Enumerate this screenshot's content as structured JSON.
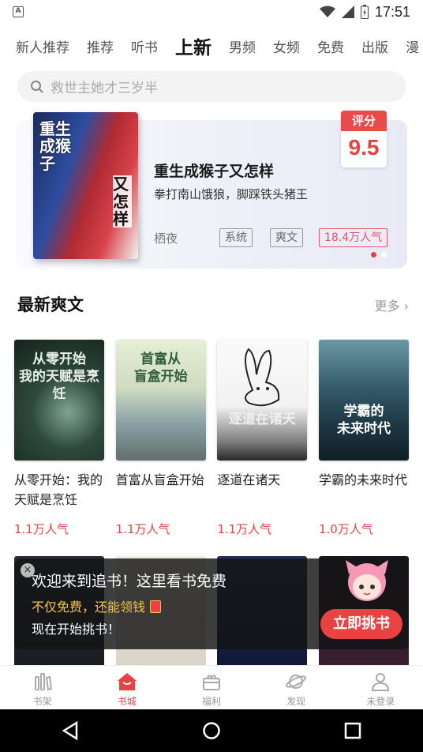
{
  "status_bar": {
    "time": "17:51",
    "left_icon": "A"
  },
  "tabs": [
    {
      "label": "新人推荐"
    },
    {
      "label": "推荐"
    },
    {
      "label": "听书"
    },
    {
      "label": "上新",
      "active": true
    },
    {
      "label": "男频"
    },
    {
      "label": "女频"
    },
    {
      "label": "免费"
    },
    {
      "label": "出版"
    },
    {
      "label": "漫"
    }
  ],
  "search": {
    "placeholder": "救世主她才三岁半"
  },
  "banner": {
    "title": "重生成猴子又怎样",
    "description": "拳打南山饿狼，脚踩铁头猪王",
    "author": "栖夜",
    "tags": [
      "系统",
      "爽文"
    ],
    "popularity": "18.4万人气",
    "score_label": "评分",
    "score_value": "9.5",
    "cover_text_1": "重生成猴子",
    "cover_text_2": "又怎样"
  },
  "section": {
    "title": "最新爽文",
    "more": "更多 ›"
  },
  "books": [
    {
      "name": "从零开始：我的天赋是烹饪",
      "popularity": "1.1万人气",
      "cover_text": "从零开始\n我的天赋是烹饪"
    },
    {
      "name": "首富从盲盒开始",
      "popularity": "1.1万人气",
      "cover_text": "首富从\n盲盒开始"
    },
    {
      "name": "逐道在诸天",
      "popularity": "1.1万人气",
      "cover_text": "逐道在诸天"
    },
    {
      "name": "学霸的未来时代",
      "popularity": "1.0万人气",
      "cover_text": "学霸的\n未来时代"
    }
  ],
  "promo": {
    "line1": "欢迎来到追书！这里看书免费",
    "line2": "不仅免费，还能领钱",
    "line3": "现在开始挑书！",
    "button": "立即挑书",
    "close": "×"
  },
  "bottom_nav": [
    {
      "label": "书架",
      "icon": "bookshelf-icon"
    },
    {
      "label": "书城",
      "icon": "bookstore-icon",
      "active": true
    },
    {
      "label": "福利",
      "icon": "gift-icon"
    },
    {
      "label": "发现",
      "icon": "planet-icon"
    },
    {
      "label": "未登录",
      "icon": "user-icon"
    }
  ],
  "colors": {
    "accent": "#e84343"
  }
}
